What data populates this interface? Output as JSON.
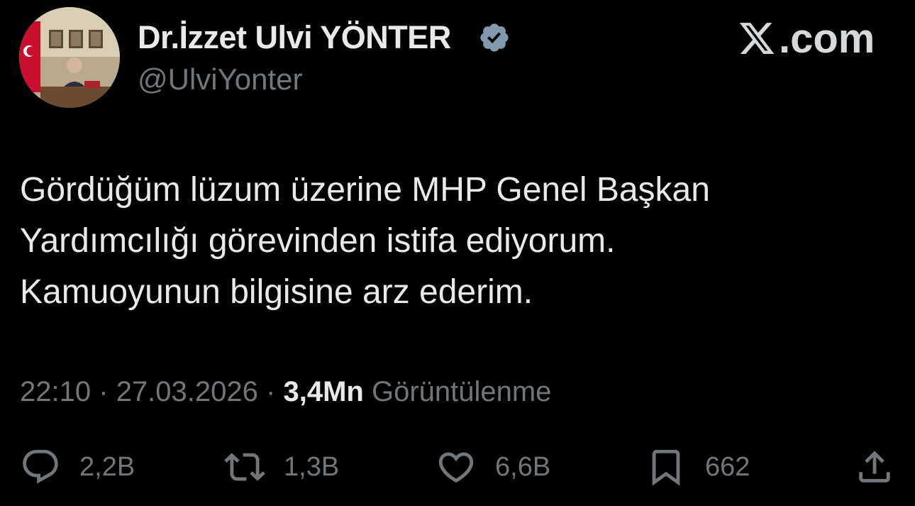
{
  "author": {
    "display_name": "Dr.İzzet Ulvi YÖNTER",
    "handle": "@UlviYonter",
    "verified": true
  },
  "brand": {
    "label": ".com",
    "logo_icon": "x-logo-icon"
  },
  "tweet": {
    "lines": [
      "Gördüğüm lüzum üzerine MHP Genel Başkan",
      "Yardımcılığı görevinden istifa ediyorum.",
      "Kamuoyunun bilgisine arz ederim."
    ]
  },
  "meta": {
    "time": "22:10",
    "separator": "·",
    "date": "27.03.2026",
    "views_count": "3,4Mn",
    "views_label": "Görüntülenme"
  },
  "actions": {
    "reply": {
      "icon": "reply-icon",
      "count": "2,2B"
    },
    "retweet": {
      "icon": "retweet-icon",
      "count": "1,3B"
    },
    "like": {
      "icon": "heart-icon",
      "count": "6,6B"
    },
    "bookmark": {
      "icon": "bookmark-icon",
      "count": "662"
    },
    "share": {
      "icon": "share-icon"
    }
  },
  "colors": {
    "background": "#000000",
    "primary_text": "#e7e9ea",
    "secondary_text": "#71767b",
    "verified_badge": "#829aab"
  }
}
